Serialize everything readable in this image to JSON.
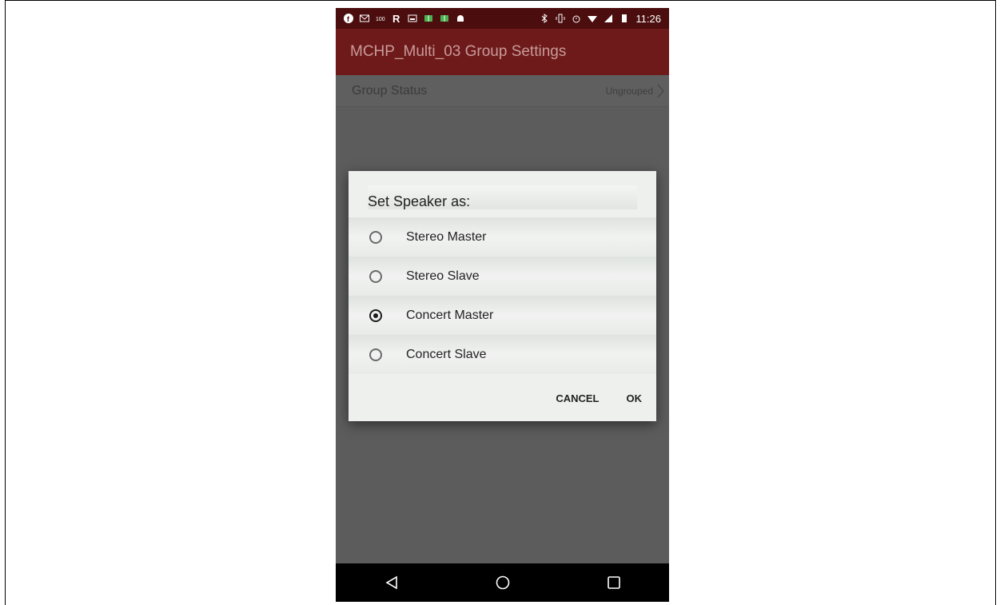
{
  "status_bar": {
    "time": "11:26",
    "left_icons": [
      "facebook-icon",
      "mail-icon",
      "temperature-icon",
      "r-icon",
      "image-icon",
      "book-icon",
      "book-icon",
      "android-icon"
    ],
    "right_icons": [
      "bluetooth-icon",
      "vibrate-icon",
      "alarm-icon",
      "wifi-icon",
      "signal-icon",
      "battery-icon"
    ]
  },
  "toolbar": {
    "title": "MCHP_Multi_03 Group Settings"
  },
  "group_status_row": {
    "label": "Group Status",
    "value": "Ungrouped"
  },
  "dialog": {
    "title": "Set Speaker as:",
    "options": [
      {
        "label": "Stereo Master",
        "selected": false
      },
      {
        "label": "Stereo Slave",
        "selected": false
      },
      {
        "label": "Concert Master",
        "selected": true
      },
      {
        "label": "Concert Slave",
        "selected": false
      }
    ],
    "cancel_label": "CANCEL",
    "ok_label": "OK"
  },
  "colors": {
    "status_bar": "#4b0d0d",
    "toolbar": "#6e1a1a",
    "scrim_background": "#5c5c5c",
    "nav_bar": "#000000"
  }
}
